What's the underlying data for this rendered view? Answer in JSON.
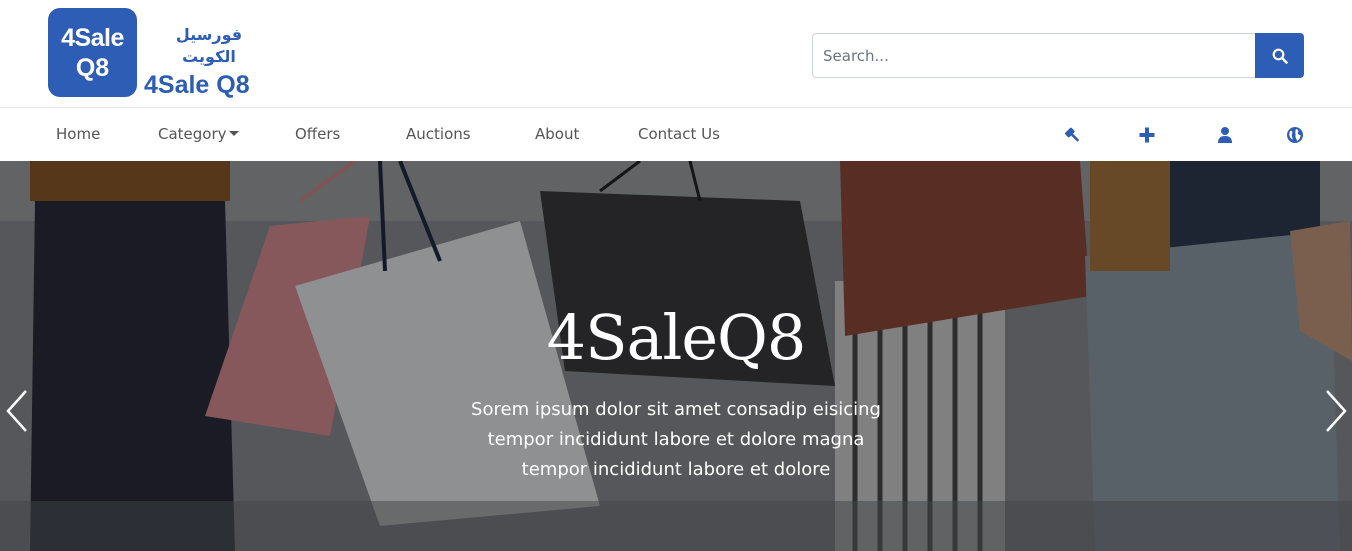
{
  "header": {
    "logo_badge": {
      "line1": "4Sale",
      "line2": "Q8"
    },
    "logo_arabic": "فورسيل الكويت",
    "logo_english": "4Sale Q8",
    "search": {
      "placeholder": "Search...",
      "button_icon": "search-icon"
    }
  },
  "nav": {
    "items": [
      {
        "label": "Home"
      },
      {
        "label": "Category",
        "has_dropdown": true
      },
      {
        "label": "Offers"
      },
      {
        "label": "Auctions"
      },
      {
        "label": "About"
      },
      {
        "label": "Contact Us"
      }
    ],
    "icons": [
      "gavel-icon",
      "plus-icon",
      "user-icon",
      "globe-icon"
    ]
  },
  "hero": {
    "title": "4SaleQ8",
    "subtitle_lines": [
      "Sorem ipsum dolor sit amet consadip eisicing",
      "tempor incididunt labore et dolore magna",
      "tempor incididunt labore et dolore"
    ],
    "prev_icon": "chevron-left-icon",
    "next_icon": "chevron-right-icon"
  },
  "colors": {
    "brand": "#2d5db4",
    "nav_text": "#555555",
    "hero_text": "#ffffff"
  }
}
